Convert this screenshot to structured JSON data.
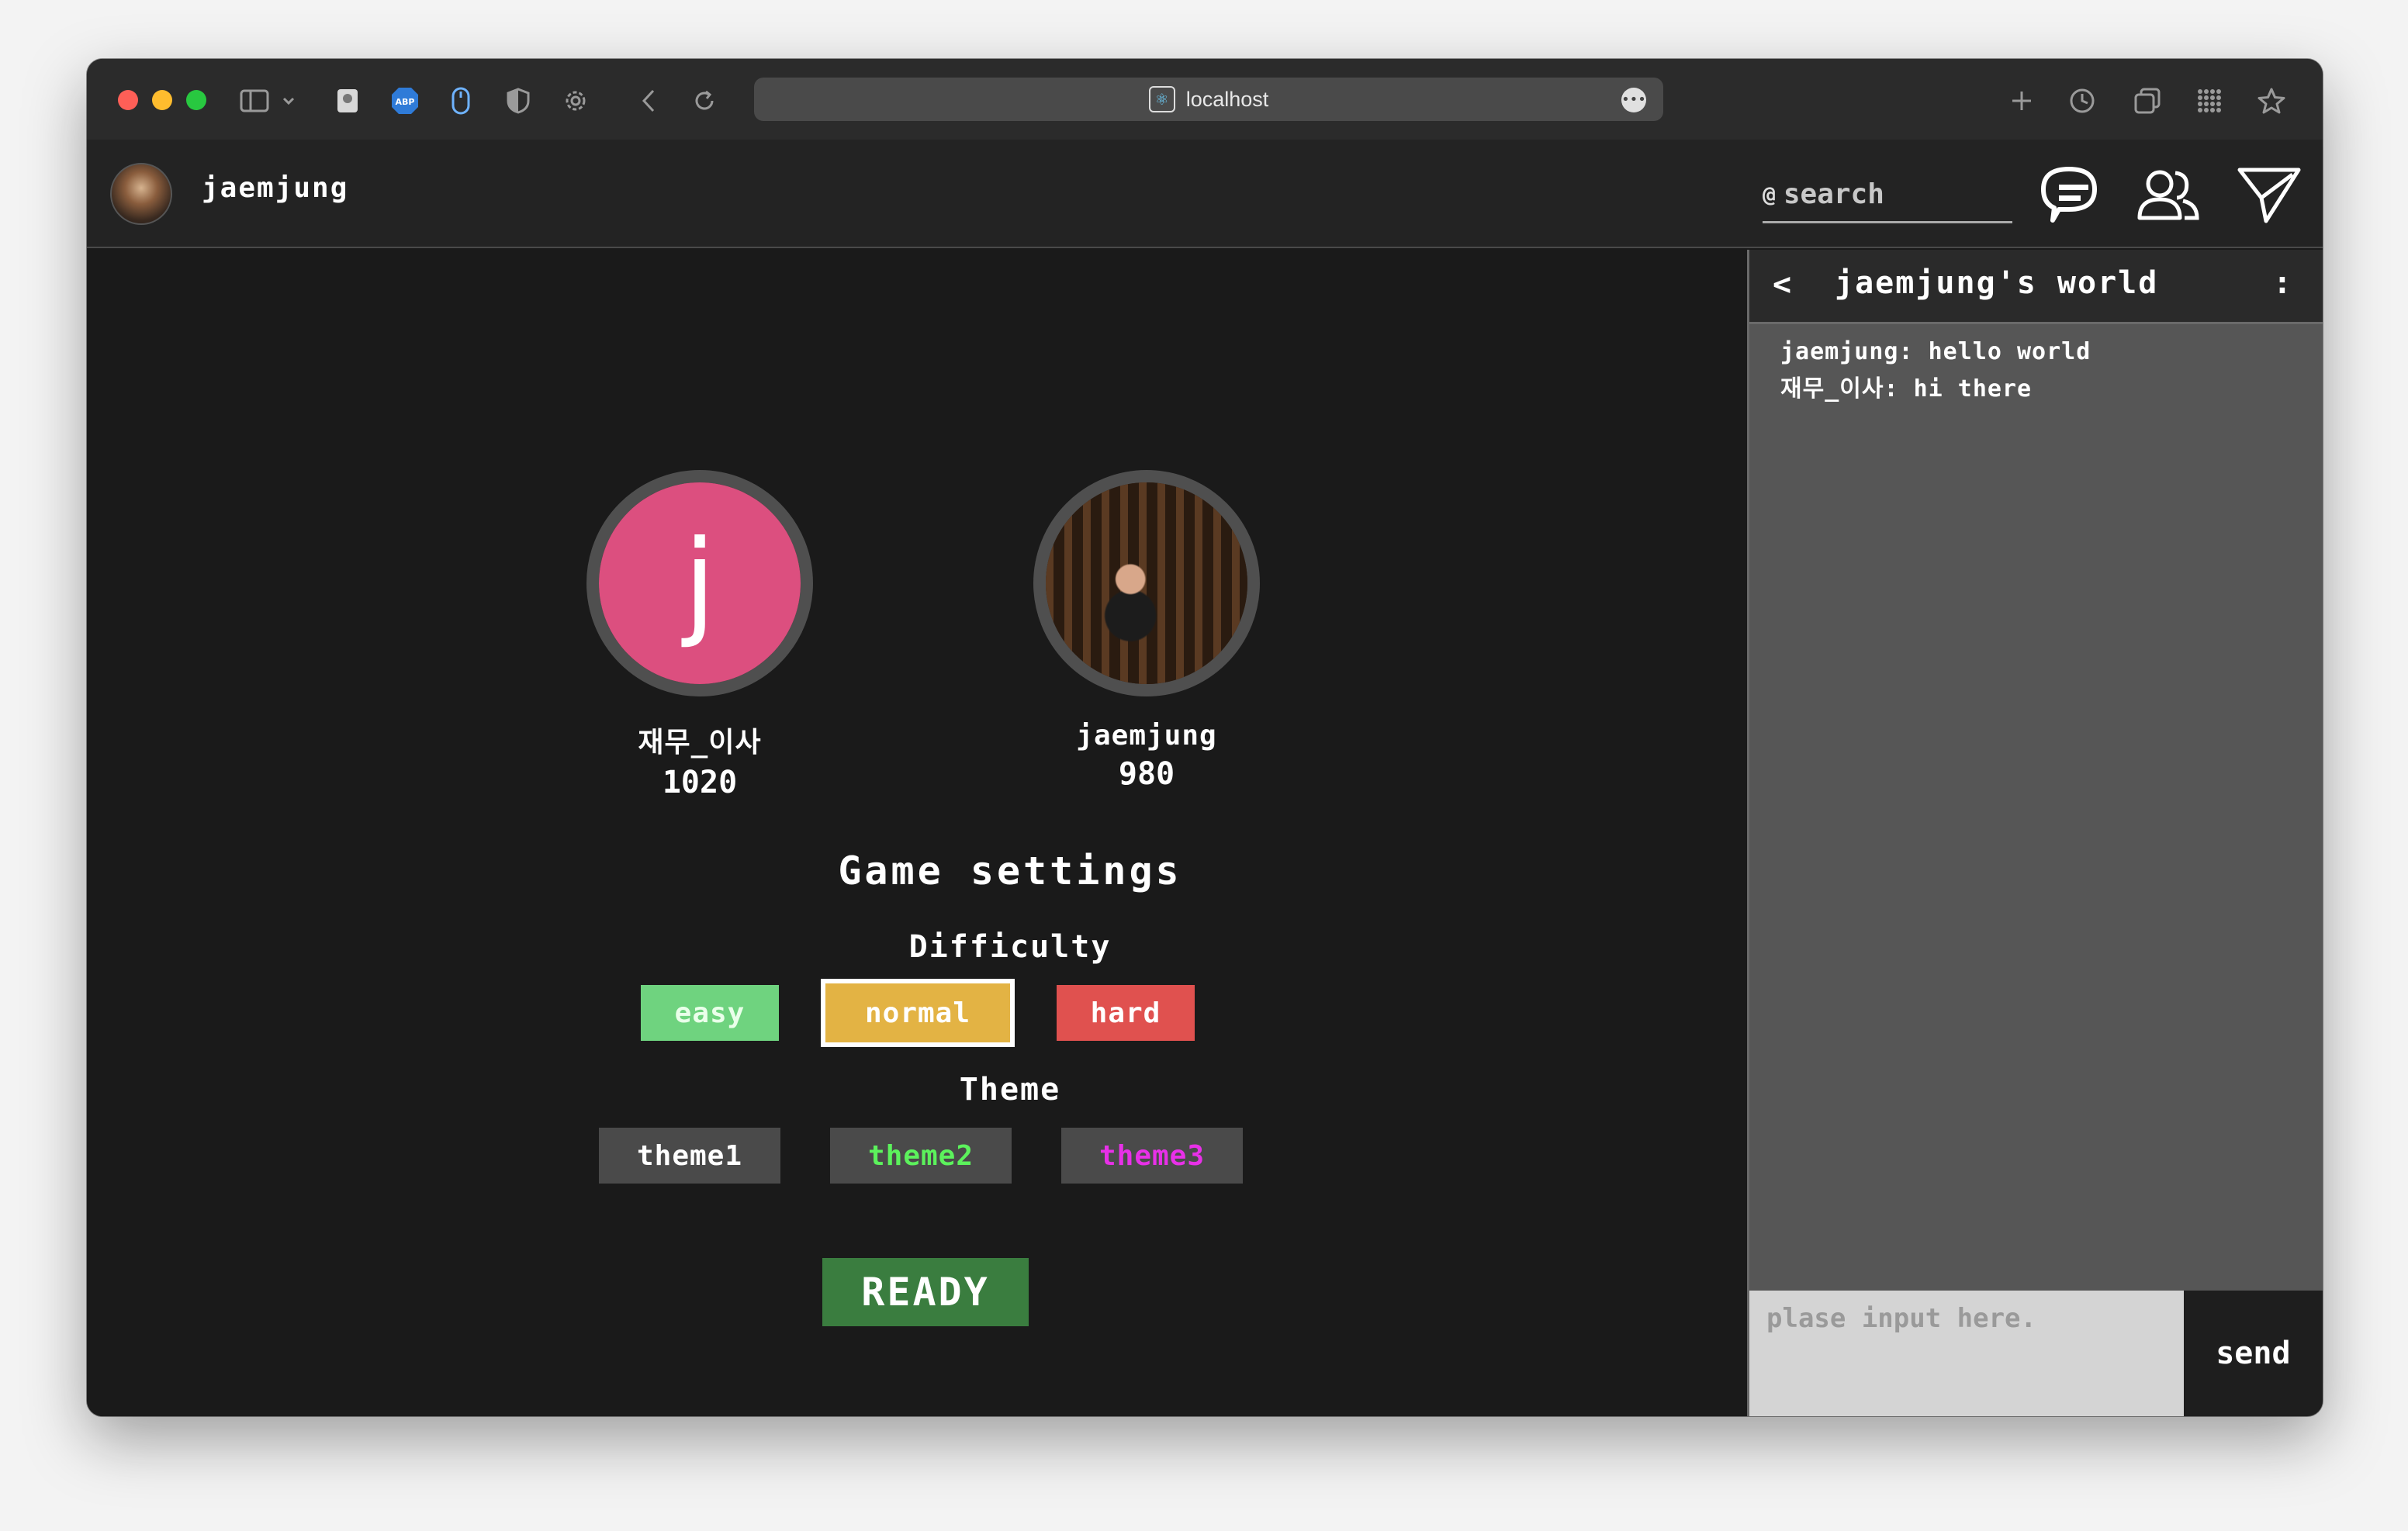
{
  "browser": {
    "url": "localhost",
    "icons": [
      "sidebar-icon",
      "chevron-down-icon",
      "extension-icon",
      "adblock-icon",
      "mouse-icon",
      "shield-icon",
      "settings-icon",
      "back-icon",
      "reload-icon",
      "more-icon",
      "new-tab-icon",
      "history-icon",
      "tabs-icon",
      "grid-icon",
      "bookmark-icon"
    ]
  },
  "header": {
    "username": "jaemjung",
    "search": {
      "prefix": "@",
      "placeholder": "search",
      "value": ""
    }
  },
  "players": [
    {
      "name": "재무_이사",
      "score": "1020",
      "initial": "j",
      "avatar_color": "#dc4f7f"
    },
    {
      "name": "jaemjung",
      "score": "980"
    }
  ],
  "settings": {
    "title": "Game settings",
    "difficulty_label": "Difficulty",
    "difficulty": [
      {
        "label": "easy",
        "color": "#6fd37f"
      },
      {
        "label": "normal",
        "color": "#e3b344",
        "selected": true
      },
      {
        "label": "hard",
        "color": "#e0514f"
      }
    ],
    "theme_label": "Theme",
    "themes": [
      {
        "label": "theme1",
        "text_color": "#ffffff"
      },
      {
        "label": "theme2",
        "text_color": "#5cf25c"
      },
      {
        "label": "theme3",
        "text_color": "#e830e8"
      }
    ],
    "ready_label": "READY",
    "ready_color": "#3a7d3f"
  },
  "chat": {
    "back": "<",
    "title": "jaemjung's world",
    "more": ":",
    "messages": [
      {
        "sender": "jaemjung",
        "text": "hello world"
      },
      {
        "sender": "재무_이사",
        "text": "hi there"
      }
    ],
    "input_placeholder": "plase input here.",
    "send_label": "send"
  }
}
